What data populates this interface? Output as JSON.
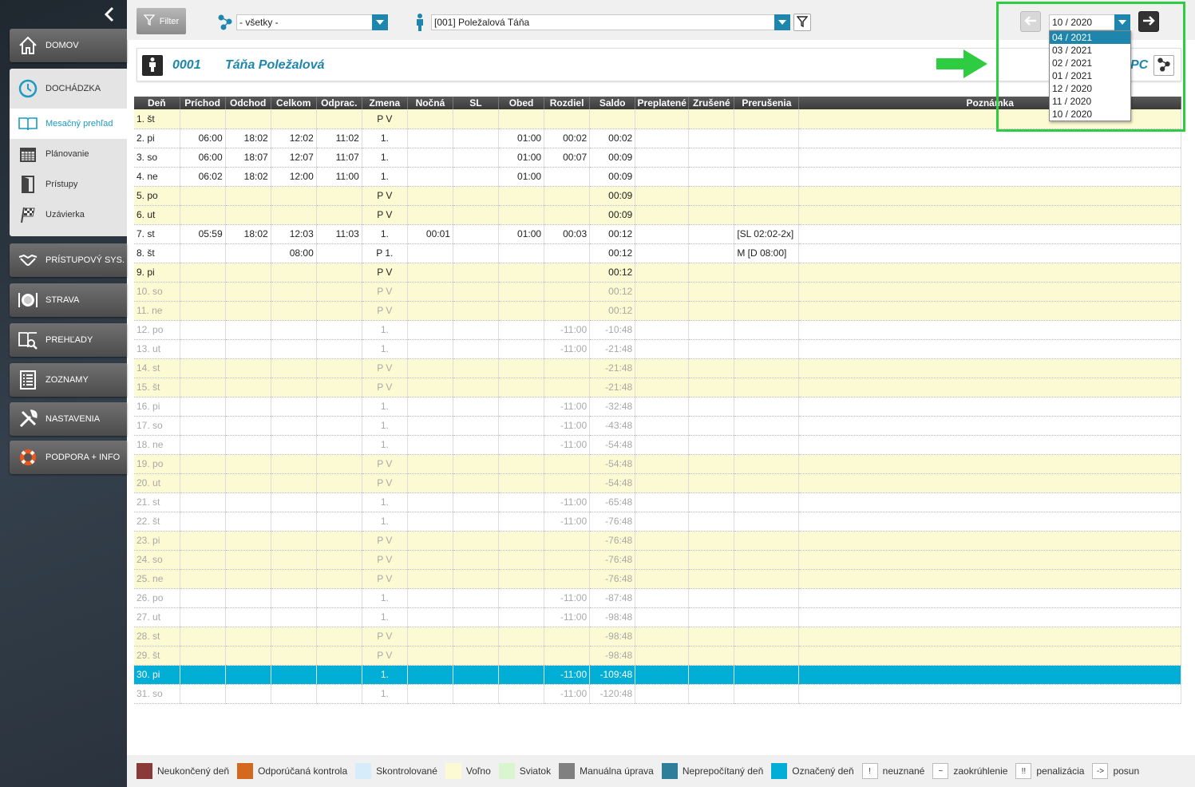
{
  "sidebar": {
    "collapse_icon": "chevron-left-icon",
    "home": "DOMOV",
    "attendance": "DOCHÁDZKA",
    "sub": [
      "Mesačný prehľad",
      "Plánovanie",
      "Prístupy",
      "Uzávierka"
    ],
    "items": [
      "PRÍSTUPOVÝ SYS.",
      "STRAVA",
      "PREHĽADY",
      "ZOZNAMY",
      "NASTAVENIA",
      "PODPORA + INFO"
    ]
  },
  "toolbar": {
    "filter_label": "Filter",
    "group_value": "- všetky -",
    "person_value": "[001] Poležalová Táňa"
  },
  "month": {
    "selected": "10 / 2020",
    "options": [
      "04 / 2021",
      "03 / 2021",
      "02 / 2021",
      "01 / 2021",
      "12 / 2020",
      "11 / 2020",
      "10 / 2020"
    ],
    "highlighted_index": 0
  },
  "person": {
    "code": "0001",
    "name": "Táňa Poležalová",
    "suffix": "PC"
  },
  "table": {
    "headers": [
      "Deň",
      "Príchod",
      "Odchod",
      "Celkom",
      "Odprac.",
      "Zmena",
      "Nočná",
      "SL",
      "Obed",
      "Rozdiel",
      "Saldo",
      "Preplatené",
      "Zrušené",
      "Prerušenia",
      "Poznámka"
    ],
    "rows": [
      {
        "t": "free",
        "c": [
          "1. št",
          "",
          "",
          "",
          "",
          "P V",
          "",
          "",
          "",
          "",
          "",
          "",
          "",
          "",
          ""
        ]
      },
      {
        "t": "",
        "c": [
          "2. pi",
          "06:00",
          "18:02",
          "12:02",
          "11:02",
          "1.",
          "",
          "",
          "01:00",
          "00:02",
          "00:02",
          "",
          "",
          "",
          ""
        ]
      },
      {
        "t": "",
        "c": [
          "3. so",
          "06:00",
          "18:07",
          "12:07",
          "11:07",
          "1.",
          "",
          "",
          "01:00",
          "00:07",
          "00:09",
          "",
          "",
          "",
          ""
        ]
      },
      {
        "t": "",
        "c": [
          "4. ne",
          "06:02",
          "18:02",
          "12:00",
          "11:00",
          "1.",
          "",
          "",
          "01:00",
          "",
          "00:09",
          "",
          "",
          "",
          ""
        ]
      },
      {
        "t": "free",
        "c": [
          "5. po",
          "",
          "",
          "",
          "",
          "P V",
          "",
          "",
          "",
          "",
          "00:09",
          "",
          "",
          "",
          ""
        ]
      },
      {
        "t": "free",
        "c": [
          "6. ut",
          "",
          "",
          "",
          "",
          "P V",
          "",
          "",
          "",
          "",
          "00:09",
          "",
          "",
          "",
          ""
        ]
      },
      {
        "t": "",
        "c": [
          "7. st",
          "05:59",
          "18:02",
          "12:03",
          "11:03",
          "1.",
          "00:01",
          "",
          "01:00",
          "00:03",
          "00:12",
          "",
          "",
          "[SL 02:02-2x]",
          ""
        ]
      },
      {
        "t": "",
        "c": [
          "8. št",
          "",
          "",
          "08:00",
          "",
          "P 1.",
          "",
          "",
          "",
          "",
          "00:12",
          "",
          "",
          "M [D 08:00]",
          ""
        ]
      },
      {
        "t": "free",
        "c": [
          "9. pi",
          "",
          "",
          "",
          "",
          "P V",
          "",
          "",
          "",
          "",
          "00:12",
          "",
          "",
          "",
          ""
        ]
      },
      {
        "t": "free fut",
        "c": [
          "10. so",
          "",
          "",
          "",
          "",
          "P V",
          "",
          "",
          "",
          "",
          "00:12",
          "",
          "",
          "",
          ""
        ]
      },
      {
        "t": "free fut",
        "c": [
          "11. ne",
          "",
          "",
          "",
          "",
          "P V",
          "",
          "",
          "",
          "",
          "00:12",
          "",
          "",
          "",
          ""
        ]
      },
      {
        "t": "fut",
        "c": [
          "12. po",
          "",
          "",
          "",
          "",
          "1.",
          "",
          "",
          "",
          "-11:00",
          "-10:48",
          "",
          "",
          "",
          ""
        ]
      },
      {
        "t": "fut",
        "c": [
          "13. ut",
          "",
          "",
          "",
          "",
          "1.",
          "",
          "",
          "",
          "-11:00",
          "-21:48",
          "",
          "",
          "",
          ""
        ]
      },
      {
        "t": "free fut",
        "c": [
          "14. st",
          "",
          "",
          "",
          "",
          "P V",
          "",
          "",
          "",
          "",
          "-21:48",
          "",
          "",
          "",
          ""
        ]
      },
      {
        "t": "free fut",
        "c": [
          "15. št",
          "",
          "",
          "",
          "",
          "P V",
          "",
          "",
          "",
          "",
          "-21:48",
          "",
          "",
          "",
          ""
        ]
      },
      {
        "t": "fut",
        "c": [
          "16. pi",
          "",
          "",
          "",
          "",
          "1.",
          "",
          "",
          "",
          "-11:00",
          "-32:48",
          "",
          "",
          "",
          ""
        ]
      },
      {
        "t": "fut",
        "c": [
          "17. so",
          "",
          "",
          "",
          "",
          "1.",
          "",
          "",
          "",
          "-11:00",
          "-43:48",
          "",
          "",
          "",
          ""
        ]
      },
      {
        "t": "fut",
        "c": [
          "18. ne",
          "",
          "",
          "",
          "",
          "1.",
          "",
          "",
          "",
          "-11:00",
          "-54:48",
          "",
          "",
          "",
          ""
        ]
      },
      {
        "t": "free fut",
        "c": [
          "19. po",
          "",
          "",
          "",
          "",
          "P V",
          "",
          "",
          "",
          "",
          "-54:48",
          "",
          "",
          "",
          ""
        ]
      },
      {
        "t": "free fut",
        "c": [
          "20. ut",
          "",
          "",
          "",
          "",
          "P V",
          "",
          "",
          "",
          "",
          "-54:48",
          "",
          "",
          "",
          ""
        ]
      },
      {
        "t": "fut",
        "c": [
          "21. st",
          "",
          "",
          "",
          "",
          "1.",
          "",
          "",
          "",
          "-11:00",
          "-65:48",
          "",
          "",
          "",
          ""
        ]
      },
      {
        "t": "fut",
        "c": [
          "22. št",
          "",
          "",
          "",
          "",
          "1.",
          "",
          "",
          "",
          "-11:00",
          "-76:48",
          "",
          "",
          "",
          ""
        ]
      },
      {
        "t": "free fut",
        "c": [
          "23. pi",
          "",
          "",
          "",
          "",
          "P V",
          "",
          "",
          "",
          "",
          "-76:48",
          "",
          "",
          "",
          ""
        ]
      },
      {
        "t": "free fut",
        "c": [
          "24. so",
          "",
          "",
          "",
          "",
          "P V",
          "",
          "",
          "",
          "",
          "-76:48",
          "",
          "",
          "",
          ""
        ]
      },
      {
        "t": "free fut",
        "c": [
          "25. ne",
          "",
          "",
          "",
          "",
          "P V",
          "",
          "",
          "",
          "",
          "-76:48",
          "",
          "",
          "",
          ""
        ]
      },
      {
        "t": "fut",
        "c": [
          "26. po",
          "",
          "",
          "",
          "",
          "1.",
          "",
          "",
          "",
          "-11:00",
          "-87:48",
          "",
          "",
          "",
          ""
        ]
      },
      {
        "t": "fut",
        "c": [
          "27. ut",
          "",
          "",
          "",
          "",
          "1.",
          "",
          "",
          "",
          "-11:00",
          "-98:48",
          "",
          "",
          "",
          ""
        ]
      },
      {
        "t": "free fut",
        "c": [
          "28. st",
          "",
          "",
          "",
          "",
          "P V",
          "",
          "",
          "",
          "",
          "-98:48",
          "",
          "",
          "",
          ""
        ]
      },
      {
        "t": "free fut",
        "c": [
          "29. št",
          "",
          "",
          "",
          "",
          "P V",
          "",
          "",
          "",
          "",
          "-98:48",
          "",
          "",
          "",
          ""
        ]
      },
      {
        "t": "sel",
        "c": [
          "30. pi",
          "",
          "",
          "",
          "",
          "1.",
          "",
          "",
          "",
          "-11:00",
          "-109:48",
          "",
          "",
          "",
          ""
        ]
      },
      {
        "t": "fut",
        "c": [
          "31. so",
          "",
          "",
          "",
          "",
          "1.",
          "",
          "",
          "",
          "-11:00",
          "-120:48",
          "",
          "",
          "",
          ""
        ]
      }
    ]
  },
  "legend": [
    {
      "label": "Neukončený deň",
      "color": "#8b3a3a"
    },
    {
      "label": "Odporúčaná kontrola",
      "color": "#d2691e"
    },
    {
      "label": "Skontrolované",
      "color": "#d6ecfa"
    },
    {
      "label": "Voľno",
      "color": "#fbfad2"
    },
    {
      "label": "Sviatok",
      "color": "#d8f5d0"
    },
    {
      "label": "Manuálna úprava",
      "color": "#808080"
    },
    {
      "label": "Neprepočítaný deň",
      "color": "#2e7d9a"
    },
    {
      "label": "Označený deň",
      "color": "#00aed6"
    },
    {
      "label": "neuznané",
      "symbol": "!"
    },
    {
      "label": "zaokrúhlenie",
      "symbol": "~"
    },
    {
      "label": "penalizácia",
      "symbol": "!!"
    },
    {
      "label": "posun",
      "symbol": "->"
    }
  ]
}
